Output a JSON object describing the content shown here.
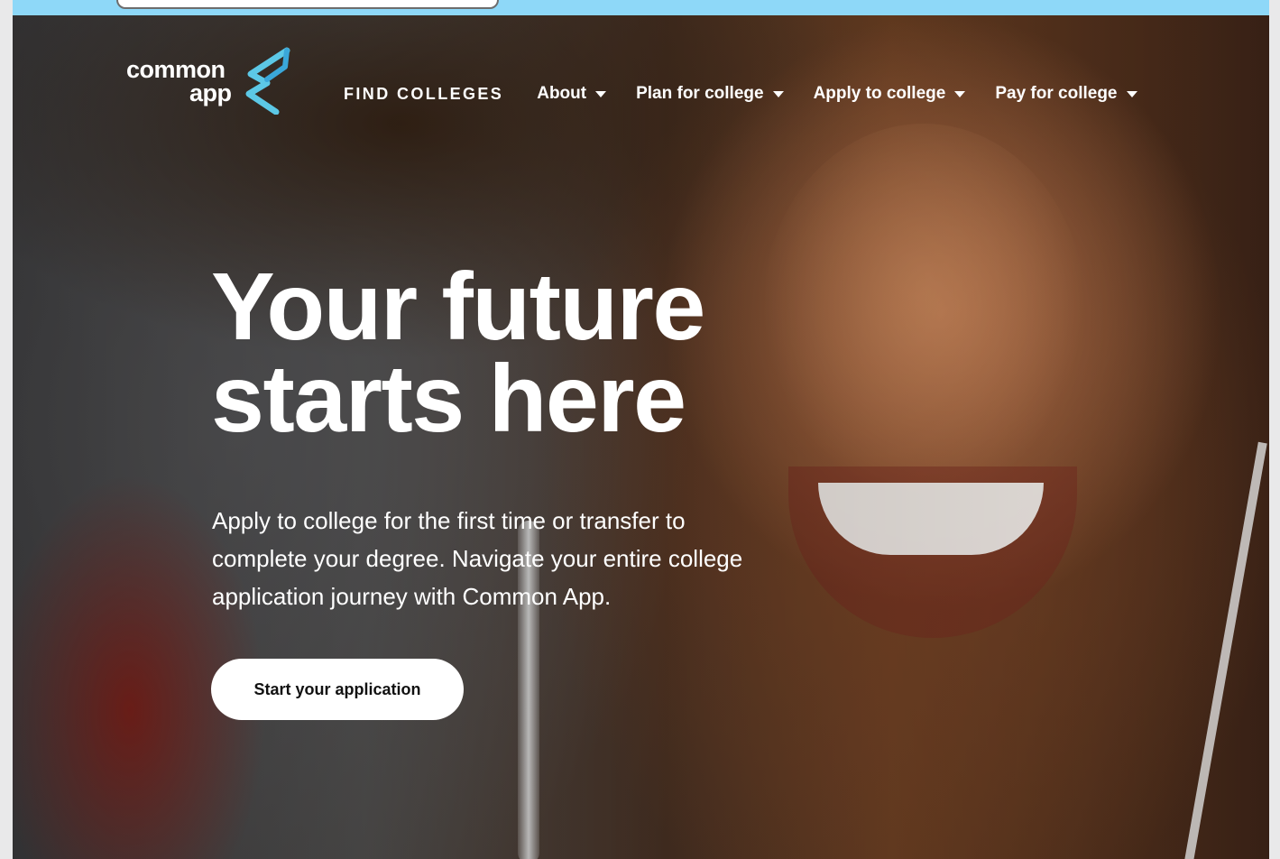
{
  "logo": {
    "word1": "common",
    "word2": "app",
    "mark_icon": "common-app-ribbon-icon",
    "colors": {
      "ribbon_primary": "#5cc8e6",
      "ribbon_secondary": "#3aa7d9"
    }
  },
  "nav": {
    "find_colleges": "FIND COLLEGES",
    "about": "About",
    "plan": "Plan for college",
    "apply": "Apply to college",
    "pay": "Pay for college",
    "dropdown_icon": "caret-down-icon"
  },
  "hero": {
    "headline_line1": "Your future",
    "headline_line2": "starts here",
    "subcopy_line1": "Apply to college for the first time or transfer to",
    "subcopy_line2": "complete your degree. Navigate your entire college",
    "subcopy_line3": "application journey with Common App.",
    "cta_label": "Start your application"
  },
  "colors": {
    "top_strip": "#8ed8f8",
    "text_on_hero": "#ffffff",
    "cta_background": "#ffffff",
    "cta_text": "#111111"
  }
}
